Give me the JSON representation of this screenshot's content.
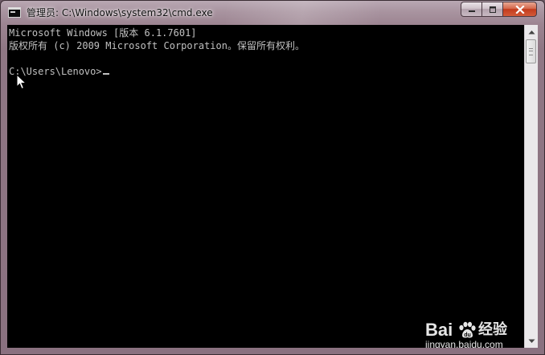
{
  "window": {
    "title": "管理员: C:\\Windows\\system32\\cmd.exe",
    "icon": "cmd-icon",
    "buttons": {
      "minimize_icon": "minimize-icon",
      "maximize_icon": "maximize-icon",
      "close_icon": "close-icon"
    }
  },
  "console": {
    "lines": [
      "Microsoft Windows [版本 6.1.7601]",
      "版权所有 (c) 2009 Microsoft Corporation。保留所有权利。",
      "",
      "C:\\Users\\Lenovo>"
    ],
    "text_color": "#c0c0c0",
    "background_color": "#000000"
  },
  "scrollbar": {
    "up_icon": "scroll-up-arrow-icon",
    "down_icon": "scroll-down-arrow-icon"
  },
  "watermark": {
    "brand_left": "Bai",
    "brand_right": "经验",
    "url": "jingyan.baidu.com",
    "logo_icon": "baidu-paw-icon"
  }
}
